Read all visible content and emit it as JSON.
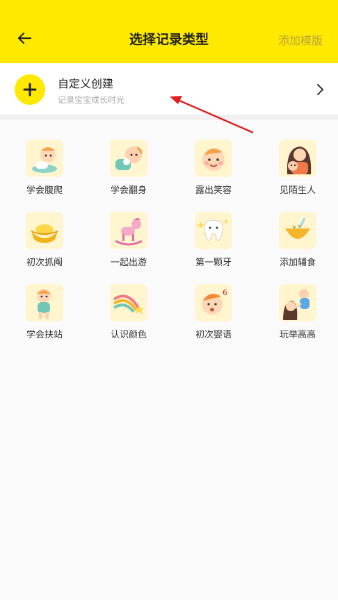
{
  "header": {
    "title": "选择记录类型",
    "right_action": "添加模版"
  },
  "custom": {
    "title": "自定义创建",
    "subtitle": "记录宝宝成长时光"
  },
  "tiles": [
    {
      "label": "学会腹爬",
      "icon": "baby-crawling-icon"
    },
    {
      "label": "学会翻身",
      "icon": "baby-rolling-icon"
    },
    {
      "label": "露出笑容",
      "icon": "baby-smile-icon"
    },
    {
      "label": "见陌生人",
      "icon": "mother-baby-icon"
    },
    {
      "label": "初次抓阄",
      "icon": "gold-ingot-icon"
    },
    {
      "label": "一起出游",
      "icon": "rocking-horse-icon"
    },
    {
      "label": "第一颗牙",
      "icon": "tooth-icon"
    },
    {
      "label": "添加辅食",
      "icon": "food-bowl-icon"
    },
    {
      "label": "学会扶站",
      "icon": "baby-standing-icon"
    },
    {
      "label": "认识颜色",
      "icon": "rainbow-star-icon"
    },
    {
      "label": "初次婴语",
      "icon": "baby-talking-icon"
    },
    {
      "label": "玩举高高",
      "icon": "lift-high-icon"
    }
  ],
  "colors": {
    "accent": "#ffe900",
    "annotation_arrow": "#e02020"
  }
}
